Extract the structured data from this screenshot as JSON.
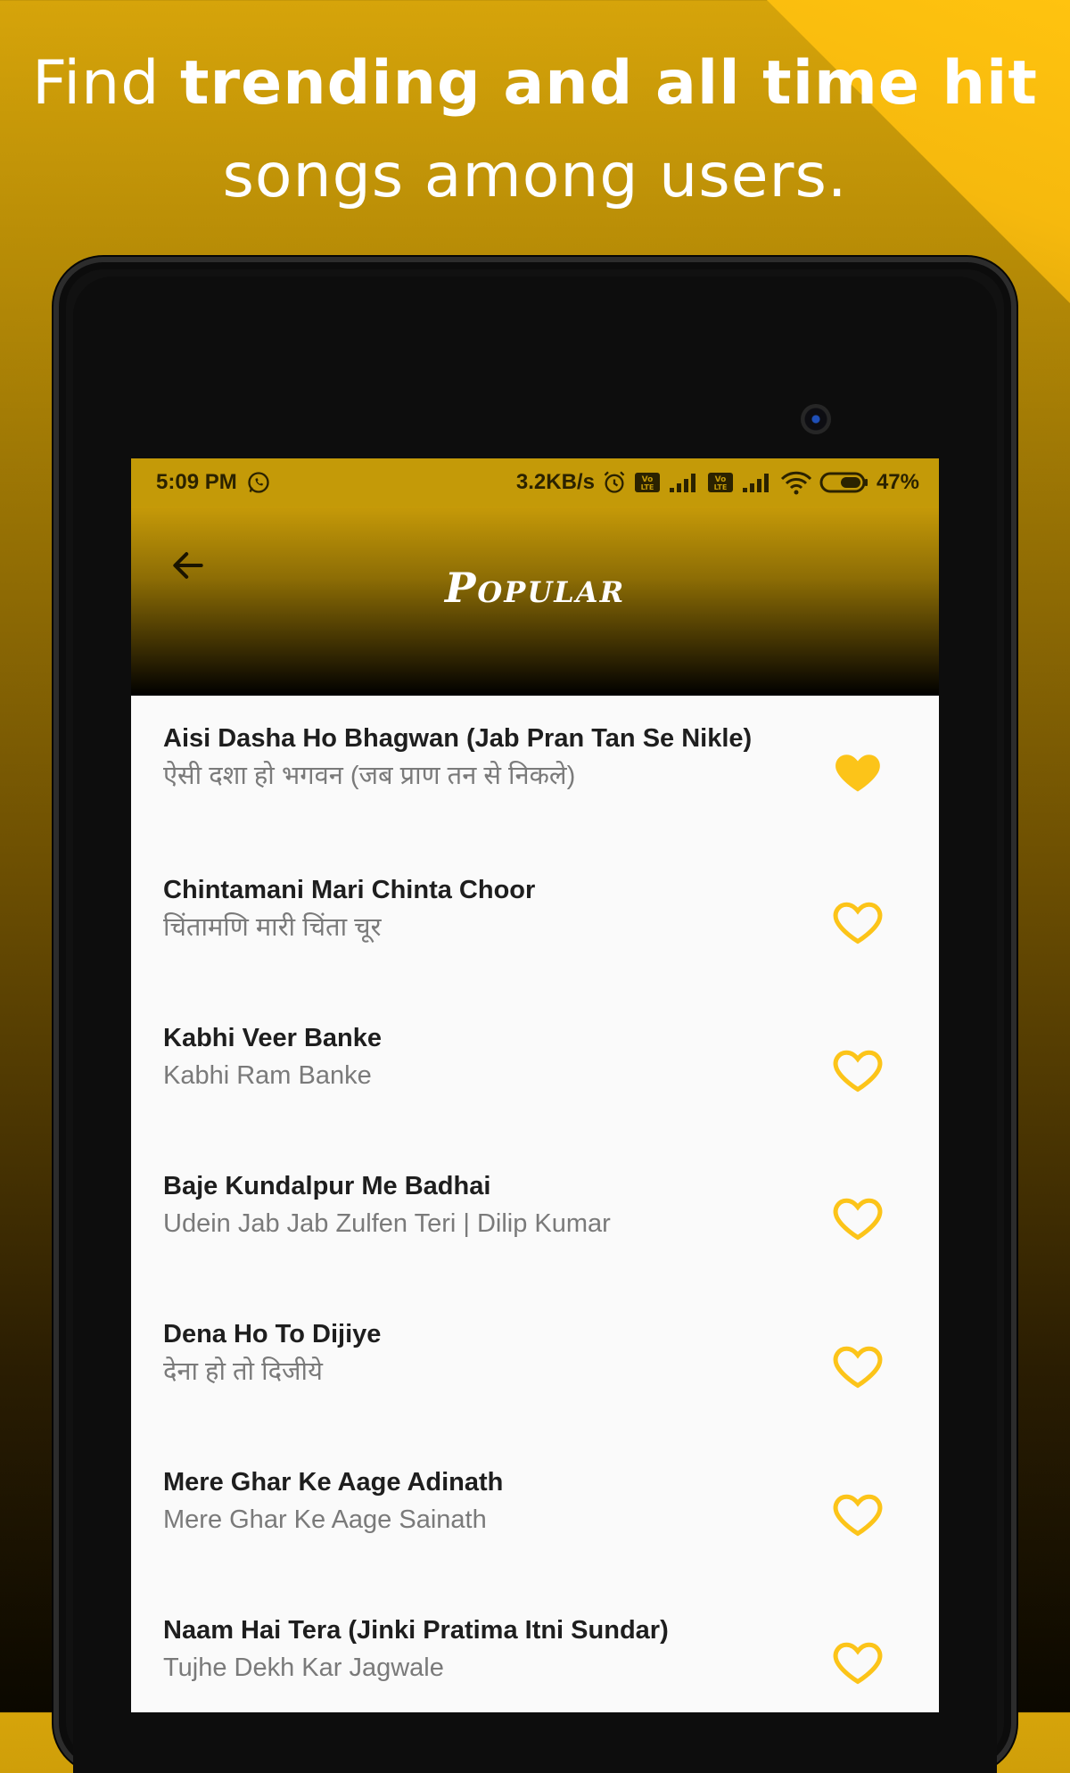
{
  "promo": {
    "line1_light": "Find ",
    "line1_bold": "trending and all time hit",
    "line2": "songs among users."
  },
  "status_bar": {
    "time": "5:09 PM",
    "net_speed": "3.2KB/s",
    "battery": "47%",
    "volte_label": "Vo LTE"
  },
  "app_bar": {
    "title": "Popular"
  },
  "colors": {
    "accent": "#fcc419",
    "status_bar": "#c49a08"
  },
  "songs": [
    {
      "title": "Aisi Dasha Ho Bhagwan (Jab Pran Tan Se Nikle)",
      "subtitle": "ऐसी दशा हो भगवन (जब प्राण तन से निकले)",
      "favorite": true
    },
    {
      "title": "Chintamani Mari Chinta Choor",
      "subtitle": "चिंतामणि मारी चिंता चूर",
      "favorite": false
    },
    {
      "title": "Kabhi Veer Banke",
      "subtitle": "Kabhi Ram Banke",
      "favorite": false
    },
    {
      "title": "Baje Kundalpur Me Badhai",
      "subtitle": "Udein Jab Jab Zulfen Teri | Dilip Kumar",
      "favorite": false
    },
    {
      "title": "Dena Ho To Dijiye",
      "subtitle": "देना हो तो दिजीये",
      "favorite": false
    },
    {
      "title": "Mere Ghar Ke Aage Adinath",
      "subtitle": "Mere Ghar Ke Aage Sainath",
      "favorite": false
    },
    {
      "title": "Naam Hai Tera (Jinki Pratima Itni Sundar)",
      "subtitle": "Tujhe Dekh Kar Jagwale",
      "favorite": false
    }
  ]
}
